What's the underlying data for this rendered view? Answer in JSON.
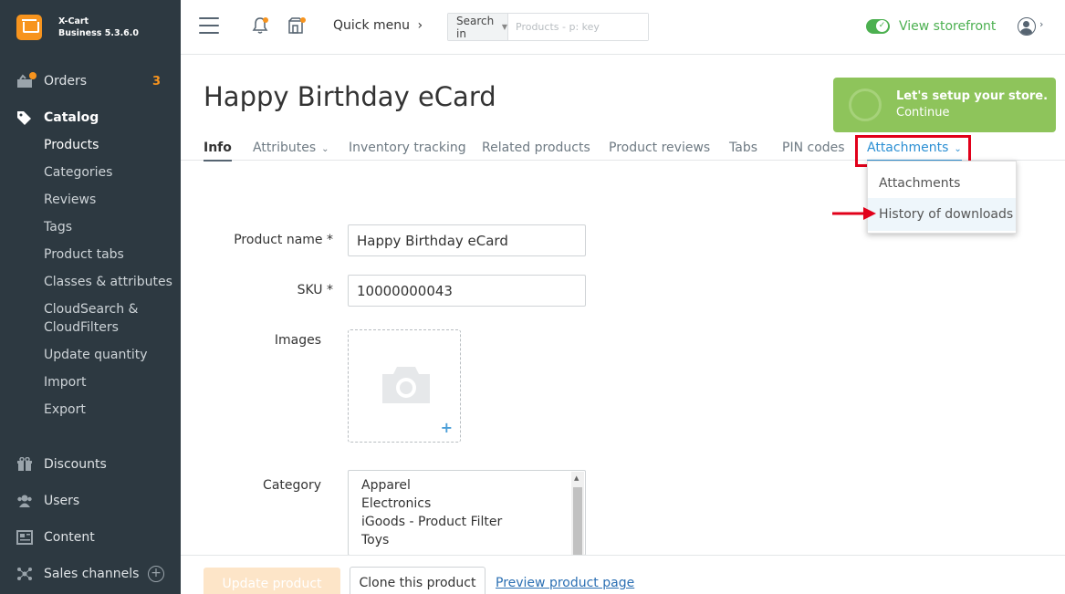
{
  "brand": {
    "name": "X-Cart",
    "version": "Business 5.3.6.0"
  },
  "sidebar": {
    "orders": {
      "label": "Orders",
      "count": "3"
    },
    "catalog": {
      "label": "Catalog"
    },
    "catalog_items": [
      "Products",
      "Categories",
      "Reviews",
      "Tags",
      "Product tabs",
      "Classes & attributes",
      "CloudSearch &",
      "CloudFilters",
      "Update quantity",
      "Import",
      "Export"
    ],
    "discounts": {
      "label": "Discounts"
    },
    "users": {
      "label": "Users"
    },
    "content": {
      "label": "Content"
    },
    "sales_channels": {
      "label": "Sales channels"
    }
  },
  "topbar": {
    "quick_menu": "Quick menu",
    "search_scope": "Search in",
    "search_placeholder": "Products - p: key",
    "view_storefront": "View storefront"
  },
  "page": {
    "title": "Happy Birthday eCard"
  },
  "setup_banner": {
    "title": "Let's setup your store.",
    "action": "Continue"
  },
  "tabs": [
    {
      "label": "Info"
    },
    {
      "label": "Attributes"
    },
    {
      "label": "Inventory tracking"
    },
    {
      "label": "Related products"
    },
    {
      "label": "Product reviews"
    },
    {
      "label": "Tabs"
    },
    {
      "label": "PIN codes"
    },
    {
      "label": "Attachments"
    }
  ],
  "attachments_menu": [
    "Attachments",
    "History of downloads"
  ],
  "form": {
    "product_name_label": "Product name *",
    "product_name_value": "Happy Birthday eCard",
    "sku_label": "SKU *",
    "sku_value": "10000000043",
    "images_label": "Images",
    "category_label": "Category",
    "categories": [
      "Apparel",
      "Electronics",
      "iGoods - Product Filter",
      "Toys"
    ]
  },
  "footer": {
    "update_button": "Update product",
    "clone_button": "Clone this product",
    "preview_link": "Preview product page"
  },
  "colors": {
    "sidebar_bg": "#2d3941",
    "accent_orange": "#f7941e",
    "accent_green": "#4cb050",
    "link_blue": "#2b8fd3",
    "highlight_red": "#e1001a"
  }
}
